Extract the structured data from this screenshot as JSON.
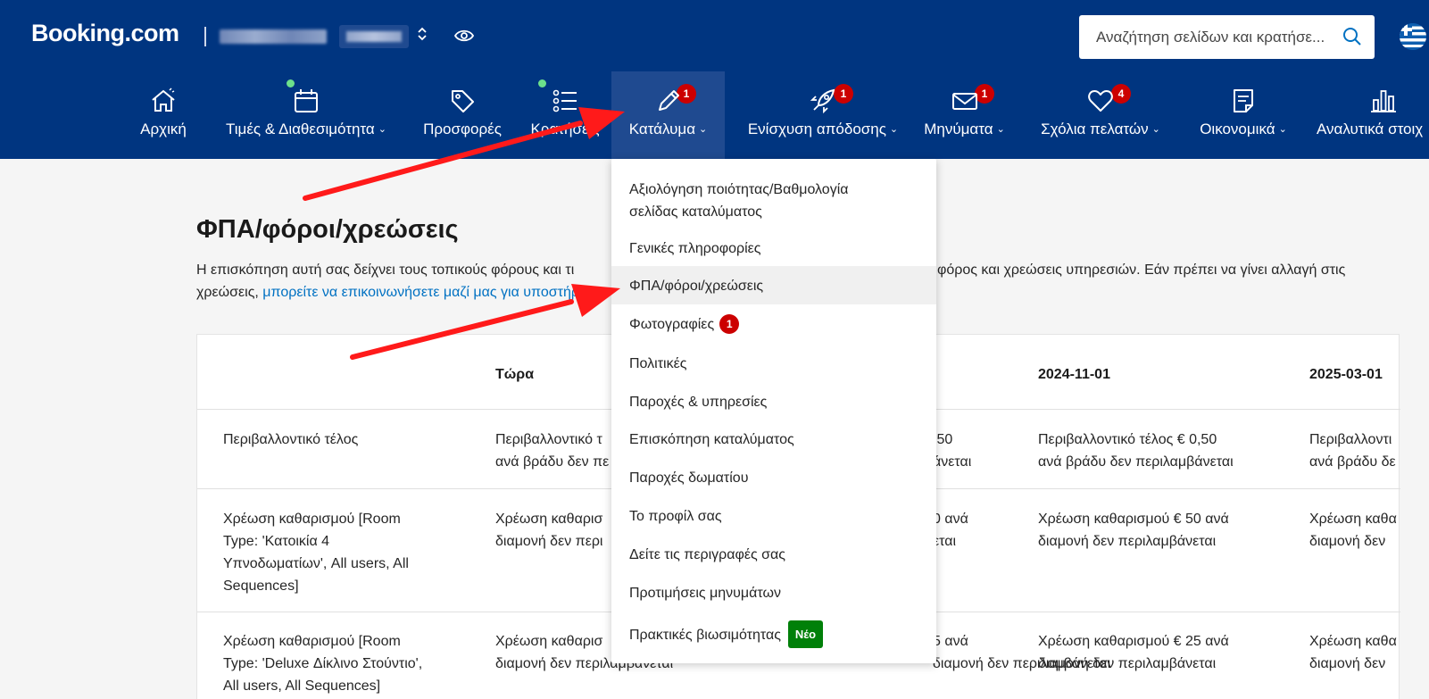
{
  "header": {
    "logo": "Booking.com",
    "search_placeholder": "Αναζήτηση σελίδων και κρατήσε...",
    "updown_glyph": "◇"
  },
  "nav": [
    {
      "label": "Αρχική",
      "icon": "home-icon"
    },
    {
      "label": "Τιμές & Διαθεσιμότητα",
      "icon": "calendar-icon",
      "dot": true,
      "chevron": true
    },
    {
      "label": "Προσφορές",
      "icon": "tag-icon"
    },
    {
      "label": "Κρατήσεις",
      "icon": "list-icon",
      "dot": true
    },
    {
      "label": "Κατάλυμα",
      "icon": "pencil-icon",
      "badge": "1",
      "chevron": true,
      "active": true
    },
    {
      "label": "Ενίσχυση απόδοσης",
      "icon": "rocket-icon",
      "badge": "1",
      "chevron": true
    },
    {
      "label": "Μηνύματα",
      "icon": "envelope-icon",
      "badge": "1",
      "chevron": true
    },
    {
      "label": "Σχόλια πελατών",
      "icon": "heart-icon",
      "badge": "4",
      "chevron": true
    },
    {
      "label": "Οικονομικά",
      "icon": "document-icon",
      "chevron": true
    },
    {
      "label": "Αναλυτικά στοιχ",
      "icon": "bar-chart-icon"
    }
  ],
  "page": {
    "title": "ΦΠΑ/φόροι/χρεώσεις",
    "intro_line1_start": "Η επισκόπηση αυτή σας δείχνει τους τοπικούς φόρους και τι",
    "intro_line1_end": "φόρος και χρεώσεις υπηρεσιών. Εάν πρέπει να γίνει αλλαγή στις",
    "intro_line2_start": "χρεώσεις,",
    "intro_link": "μπορείτε να επικοινωνήσετε μαζί μας για υποστήρ"
  },
  "table": {
    "headers": [
      "",
      "Τώρα",
      "",
      "2024-11-01",
      "2025-03-01"
    ],
    "rows": [
      {
        "name": "Περιβαλλοντικό τέλος",
        "now": "Περιβαλλοντικό τ\nανά βράδυ δεν πε",
        "mid": ",50\nάνεται",
        "d1": "Περιβαλλοντικό τέλος € 0,50\nανά βράδυ δεν περιλαμβάνεται",
        "d2": "Περιβαλλοντι\nανά βράδυ δε"
      },
      {
        "name": "Χρέωση καθαρισμού [Room\nType: 'Κατοικία 4\nΥπνοδωματίων', All users, All\nSequences]",
        "now": "Χρέωση καθαρισ\nδιαμονή δεν περι",
        "mid": "0 ανά\nεται",
        "d1": "Χρέωση καθαρισμού € 50 ανά\nδιαμονή δεν περιλαμβάνεται",
        "d2": "Χρέωση καθα\nδιαμονή δεν"
      },
      {
        "name": "Χρέωση καθαρισμού [Room\nType: 'Deluxe Δίκλινο Στούντιο',\nAll users, All Sequences]",
        "now": "Χρέωση καθαρισ\nδιαμονή δεν περιλαμβάνεται",
        "mid": "5 ανά\nδιαμονή δεν περιλαμβάνεται",
        "d1": "Χρέωση καθαρισμού € 25 ανά\nδιαμονή δεν περιλαμβάνεται",
        "d2": "Χρέωση καθα\nδιαμονή δεν"
      }
    ]
  },
  "dropdown": {
    "items": [
      {
        "label": "Αξιολόγηση ποιότητας/Βαθμολογία\nσελίδας καταλύματος"
      },
      {
        "label": "Γενικές πληροφορίες"
      },
      {
        "label": "ΦΠΑ/φόροι/χρεώσεις",
        "selected": true
      },
      {
        "label": "Φωτογραφίες",
        "badge": "1"
      },
      {
        "label": "Πολιτικές"
      },
      {
        "label": "Παροχές & υπηρεσίες"
      },
      {
        "label": "Επισκόπηση καταλύματος"
      },
      {
        "label": "Παροχές δωματίου"
      },
      {
        "label": "Το προφίλ σας"
      },
      {
        "label": "Δείτε τις περιγραφές σας"
      },
      {
        "label": "Προτιμήσεις μηνυμάτων"
      },
      {
        "label": "Πρακτικές βιωσιμότητας",
        "tag": "Νέο"
      }
    ]
  },
  "colors": {
    "brand_blue": "#003580",
    "active_blue": "#1f4a90",
    "badge_red": "#cc0000",
    "new_green": "#008009",
    "link_blue": "#0071c2",
    "annotation_red": "#ff1a1a"
  }
}
